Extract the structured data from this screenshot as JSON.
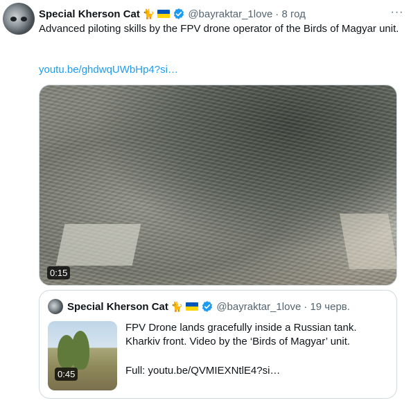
{
  "tweet": {
    "author_name": "Special Kherson Cat",
    "author_emoji": "🐈",
    "handle": "@bayraktar_1love",
    "time": "· 8 год",
    "more": "···",
    "text": "Advanced piloting skills by the FPV drone operator of the Birds of Magyar unit.",
    "link": "youtu.be/ghdwqUWbHp4?si…",
    "video_duration": "0:15"
  },
  "quoted_tweet": {
    "author_name": "Special Kherson Cat",
    "author_emoji": "🐈",
    "handle": "@bayraktar_1love",
    "time": "· 19 черв.",
    "text": "FPV Drone lands gracefully inside a Russian tank. Kharkiv front. Video by the ‘Birds of Magyar’ unit.",
    "full_link": "Full: youtu.be/QVMIEXNtlE4?si…",
    "video_duration": "0:45"
  },
  "colors": {
    "link": "#1d9bf0",
    "verified": "#1d9bf0",
    "flag_blue": "#0057b7",
    "flag_yellow": "#ffd700",
    "secondary_text": "#536471"
  },
  "icons": [
    "avatar",
    "cat-emoji",
    "ukraine-flag-icon",
    "verified-badge-icon",
    "more-options-icon"
  ]
}
